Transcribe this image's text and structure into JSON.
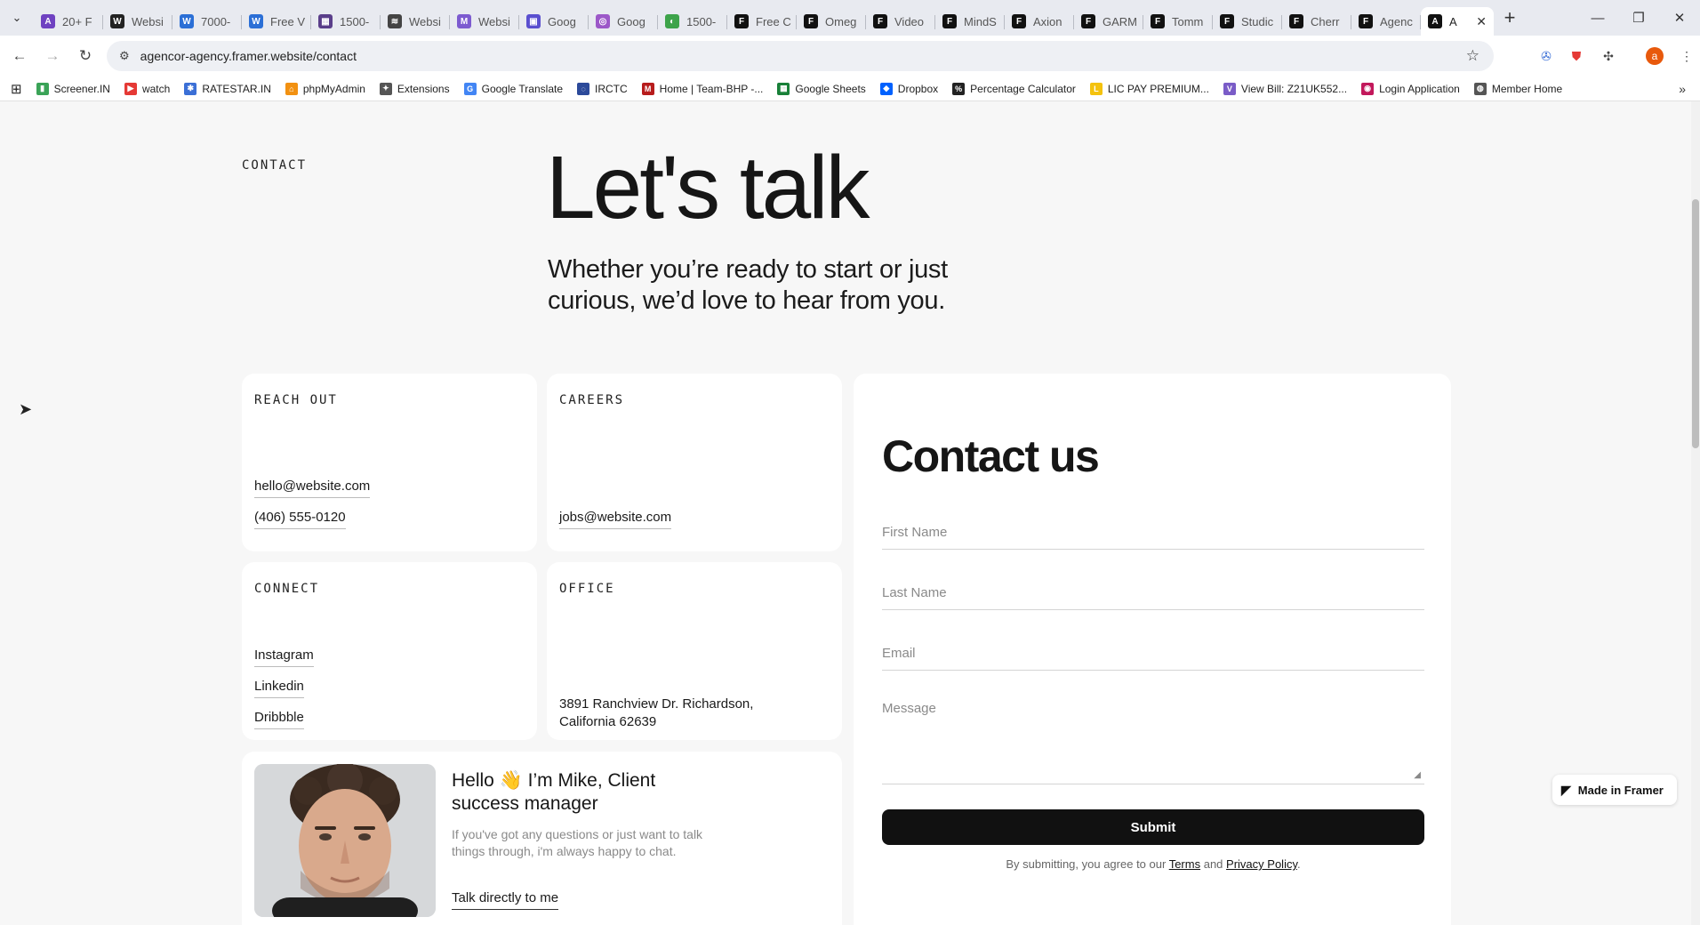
{
  "browser": {
    "tabs": [
      {
        "label": "20+ F",
        "color": "#6f42c1",
        "glyph": "A"
      },
      {
        "label": "Websi",
        "color": "#222222",
        "glyph": "W"
      },
      {
        "label": "7000-",
        "color": "#2b6fd6",
        "glyph": "W"
      },
      {
        "label": "Free V",
        "color": "#2b6fd6",
        "glyph": "W"
      },
      {
        "label": "1500-",
        "color": "#5a3e8a",
        "glyph": "▦"
      },
      {
        "label": "Websi",
        "color": "#444444",
        "glyph": "≋"
      },
      {
        "label": "Websi",
        "color": "#7d5bd0",
        "glyph": "M"
      },
      {
        "label": "Goog",
        "color": "#5a4fcf",
        "glyph": "▣"
      },
      {
        "label": "Goog",
        "color": "#9c58c8",
        "glyph": "◎"
      },
      {
        "label": "1500-",
        "color": "#3da34a",
        "glyph": "◐"
      },
      {
        "label": "Free C",
        "color": "#111111",
        "glyph": "F"
      },
      {
        "label": "Omeg",
        "color": "#111111",
        "glyph": "F"
      },
      {
        "label": "Video",
        "color": "#111111",
        "glyph": "F"
      },
      {
        "label": "MindS",
        "color": "#111111",
        "glyph": "F"
      },
      {
        "label": "Axion",
        "color": "#111111",
        "glyph": "F"
      },
      {
        "label": "GARM",
        "color": "#111111",
        "glyph": "F"
      },
      {
        "label": "Tomm",
        "color": "#111111",
        "glyph": "F"
      },
      {
        "label": "Studic",
        "color": "#111111",
        "glyph": "F"
      },
      {
        "label": "Cherr",
        "color": "#111111",
        "glyph": "F"
      },
      {
        "label": "Agenc",
        "color": "#111111",
        "glyph": "F"
      }
    ],
    "active_tab": {
      "label": "A",
      "color": "#111111",
      "glyph": "A"
    },
    "url": "agencor-agency.framer.website/contact",
    "bookmarks": [
      {
        "label": "Screener.IN",
        "color": "#3aa357",
        "glyph": "▮"
      },
      {
        "label": "watch",
        "color": "#e53935",
        "glyph": "▶"
      },
      {
        "label": "RATESTAR.IN",
        "color": "#3b6fd6",
        "glyph": "✱"
      },
      {
        "label": "phpMyAdmin",
        "color": "#f29111",
        "glyph": "⌂"
      },
      {
        "label": "Extensions",
        "color": "#555555",
        "glyph": "✦"
      },
      {
        "label": "Google Translate",
        "color": "#4285f4",
        "glyph": "G"
      },
      {
        "label": "IRCTC",
        "color": "#2c4a9a",
        "glyph": "◌"
      },
      {
        "label": "Home | Team-BHP -...",
        "color": "#b71c1c",
        "glyph": "M"
      },
      {
        "label": "Google Sheets",
        "color": "#188038",
        "glyph": "▦"
      },
      {
        "label": "Dropbox",
        "color": "#0061fe",
        "glyph": "◆"
      },
      {
        "label": "Percentage Calculator",
        "color": "#222222",
        "glyph": "%"
      },
      {
        "label": "LIC PAY PREMIUM...",
        "color": "#f4c20d",
        "glyph": "L"
      },
      {
        "label": "View Bill: Z21UK552...",
        "color": "#7a5cc7",
        "glyph": "V"
      },
      {
        "label": "Login Application",
        "color": "#c2185b",
        "glyph": "◉"
      },
      {
        "label": "Member Home",
        "color": "#555555",
        "glyph": "◍"
      }
    ]
  },
  "page": {
    "contact_label": "CONTACT",
    "hero_title": "Let's talk",
    "hero_subtitle": "Whether you’re ready to start or just curious, we’d love to hear from you.",
    "reach_out": {
      "title": "REACH OUT",
      "email": "hello@website.com",
      "phone": "(406) 555-0120"
    },
    "careers": {
      "title": "CAREERS",
      "email": "jobs@website.com"
    },
    "connect": {
      "title": "CONNECT",
      "links": [
        "Instagram",
        "Linkedin",
        "Dribbble"
      ]
    },
    "office": {
      "title": "OFFICE",
      "address_line1": "3891 Ranchview Dr. Richardson,",
      "address_line2": "California 62639"
    },
    "mike": {
      "heading": "Hello 👋 I’m Mike, Client success manager",
      "text": "If you've got any questions or just want to talk things through, i'm always happy to chat.",
      "link": "Talk directly to me"
    },
    "form": {
      "title": "Contact us",
      "first_name_placeholder": "First Name",
      "last_name_placeholder": "Last Name",
      "email_placeholder": "Email",
      "message_placeholder": "Message",
      "submit_label": "Submit",
      "agree_prefix": "By submitting, you agree to our",
      "terms_label": "Terms",
      "and_label": "and",
      "privacy_label": "Privacy Policy",
      "agree_suffix": "."
    },
    "badge": "Made in Framer"
  }
}
